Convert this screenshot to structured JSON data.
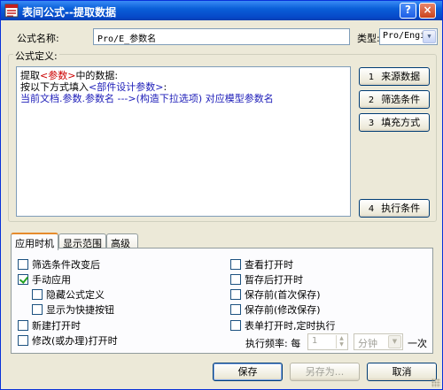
{
  "window": {
    "title": "表间公式--提取数据"
  },
  "titlebar": {
    "help_label": "?",
    "close_label": "×"
  },
  "form": {
    "formula_name_label": "公式名称:",
    "formula_name_value": "Pro/E_参数名",
    "type_label": "类型:",
    "type_value": "Pro/Engi",
    "definition_label": "公式定义:"
  },
  "definition": {
    "line1": {
      "pre": "提取",
      "tag": "<参数>",
      "post": "中的数据:"
    },
    "line2": {
      "pre": "按以下方式填入",
      "tag": "<部件设计参数>",
      "post": ":"
    },
    "line3": "当前文档.参数.参数名  --->(构造下拉选项)  对应模型参数名"
  },
  "side_buttons": [
    {
      "num": "1",
      "label": "来源数据"
    },
    {
      "num": "2",
      "label": "筛选条件"
    },
    {
      "num": "3",
      "label": "填充方式"
    },
    {
      "num": "4",
      "label": "执行条件"
    }
  ],
  "tabs": [
    {
      "label": "应用时机",
      "active": true
    },
    {
      "label": "显示范围",
      "active": false
    },
    {
      "label": "高级",
      "active": false
    }
  ],
  "options_left": [
    {
      "label": "筛选条件改变后",
      "checked": false
    },
    {
      "label": "手动应用",
      "checked": true
    },
    {
      "label": "隐藏公式定义",
      "checked": false
    },
    {
      "label": "显示为快捷按钮",
      "checked": false
    },
    {
      "label": "新建打开时",
      "checked": false
    },
    {
      "label": "修改(或办理)打开时",
      "checked": false
    }
  ],
  "options_right": [
    {
      "label": "查看打开时",
      "checked": false
    },
    {
      "label": "暂存后打开时",
      "checked": false
    },
    {
      "label": "保存前(首次保存)",
      "checked": false
    },
    {
      "label": "保存前(修改保存)",
      "checked": false
    },
    {
      "label": "表单打开时,定时执行",
      "checked": false
    }
  ],
  "frequency": {
    "label": "执行频率: 每",
    "value": "1",
    "unit": "分钟",
    "suffix": "一次"
  },
  "footer": {
    "save_label": "保存",
    "save_as_label": "另存为...",
    "cancel_label": "取消"
  },
  "colors": {
    "titlebar": "#0a5fd8",
    "tag_red": "#cc0000",
    "text_blue": "#1c1cb8",
    "tab_accent": "#e68b2c"
  }
}
